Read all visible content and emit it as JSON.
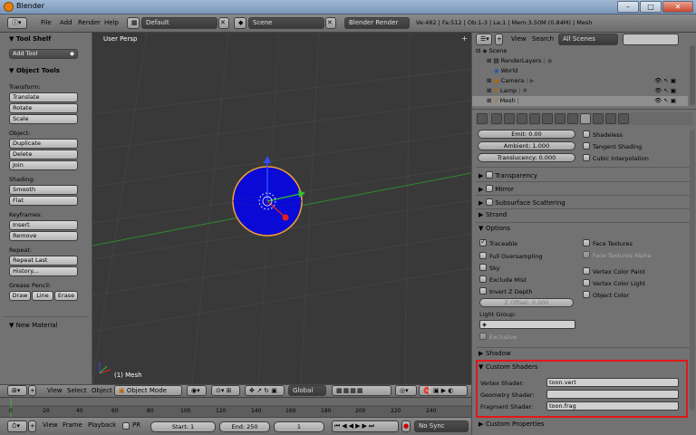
{
  "window": {
    "title": "Blender",
    "controls": [
      "–",
      "□",
      "✕"
    ]
  },
  "info": {
    "menus": [
      "File",
      "Add",
      "Render",
      "Help"
    ],
    "screen_layout": "Default",
    "scene": "Scene",
    "engine": "Blender Render",
    "stats": "Ve:482 | Fa:512 | Ob:1-3 | La:1 | Mem:3.50M (0.84M) | Mesh"
  },
  "tool_shelf": {
    "title": "Tool Shelf",
    "add_tool": "Add Tool",
    "object_tools": "Object Tools",
    "groups": [
      {
        "label": "Transform:",
        "buttons": [
          "Translate",
          "Rotate",
          "Scale"
        ]
      },
      {
        "label": "Object:",
        "buttons": [
          "Duplicate",
          "Delete",
          "Join"
        ]
      },
      {
        "label": "Shading:",
        "buttons": [
          "Smooth",
          "Flat"
        ]
      },
      {
        "label": "Keyframes:",
        "buttons": [
          "Insert",
          "Remove"
        ]
      },
      {
        "label": "Repeat:",
        "buttons": [
          "Repeat Last",
          "History..."
        ]
      }
    ],
    "grease_pencil": {
      "label": "Grease Pencil:",
      "buttons": [
        "Draw",
        "Line",
        "Erase"
      ]
    },
    "new_material": "New Material"
  },
  "viewport": {
    "view_name": "User Persp",
    "object_label": "(1) Mesh",
    "sphere_color": "#0a0ad6",
    "outline_color": "#f0a030"
  },
  "view3d_header": {
    "menus": [
      "View",
      "Select",
      "Object"
    ],
    "mode": "Object Mode",
    "orientation": "Global"
  },
  "timeline": {
    "ticks": [
      "0",
      "20",
      "40",
      "60",
      "80",
      "100",
      "120",
      "140",
      "160",
      "180",
      "200",
      "220",
      "240"
    ],
    "menus": [
      "View",
      "Frame",
      "Playback"
    ],
    "pr": "PR",
    "start": "Start: 1",
    "end": "End: 250",
    "current": "1",
    "sync": "No Sync"
  },
  "outliner": {
    "menus": [
      "View",
      "Search"
    ],
    "filter": "All Scenes",
    "items": [
      {
        "label": "Scene",
        "depth": 0
      },
      {
        "label": "RenderLayers",
        "depth": 1
      },
      {
        "label": "World",
        "depth": 1
      },
      {
        "label": "Camera",
        "depth": 1
      },
      {
        "label": "Lamp",
        "depth": 1
      },
      {
        "label": "Mesh",
        "depth": 1
      }
    ]
  },
  "properties": {
    "emit": "Emit: 0.00",
    "ambient": "Ambient: 1.000",
    "translucency": "Translucency: 0.000",
    "shadeless": "Shadeless",
    "tangent_shading": "Tangent Shading",
    "cubic_interpolation": "Cubic Interpolation",
    "panels": [
      "Transparency",
      "Mirror",
      "Subsurface Scattering",
      "Strand"
    ],
    "options": {
      "title": "Options",
      "left": [
        "Traceable",
        "Full Oversampling",
        "Sky",
        "Exclude Mist",
        "Invert Z Depth"
      ],
      "right": [
        "Face Textures",
        "Face Textures Alpha",
        "Vertex Color Paint",
        "Vertex Color Light",
        "Object Color"
      ],
      "z_offset": "Z Offset: 0.000",
      "light_group": "Light Group:",
      "exclusive": "Exclusive"
    },
    "shadow": "Shadow",
    "custom_shaders": {
      "title": "Custom Shaders",
      "vertex_label": "Vertex Shader:",
      "vertex_value": "toon.vert",
      "geometry_label": "Geometry Shader:",
      "geometry_value": "",
      "fragment_label": "Fragment Shader:",
      "fragment_value": "toon.frag"
    },
    "custom_properties": "Custom Properties"
  },
  "colors": {
    "highlight_box": "#e01818",
    "viewport_bg": "#393939",
    "panel_bg": "#727272"
  }
}
